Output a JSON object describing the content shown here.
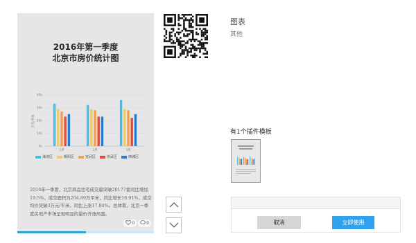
{
  "preview": {
    "title_line1": "2016年第一季度",
    "title_line2": "北京市房价统计图",
    "description": "2016年一季度，北京商品住宅成交量突破20177套同比增加19.5%，成交面积为204.89万平米，同比增长16.91%，成交均价突破3万元/平米，同比上涨17.84%。总体看，北京一季度房地产市场呈现明显的量价齐涨局面。",
    "likes": "0",
    "comments": "0",
    "progress": 0.5
  },
  "chart_data": {
    "type": "bar",
    "ylabel": "万元/平米",
    "yticks": [
      "0k",
      "10k",
      "20k",
      "30k",
      "40k"
    ],
    "ylim": [
      0,
      40
    ],
    "categories": [
      "1月",
      "2月",
      "3月"
    ],
    "series": [
      {
        "name": "海淀区",
        "color": "#3ec1f0",
        "values": [
          33,
          32,
          36
        ]
      },
      {
        "name": "朝阳区",
        "color": "#f5c86a",
        "values": [
          29,
          29,
          29
        ]
      },
      {
        "name": "宣武区",
        "color": "#f5a04a",
        "values": [
          27,
          28,
          28
        ]
      },
      {
        "name": "崇武区",
        "color": "#e8483c",
        "values": [
          23,
          23,
          22
        ]
      },
      {
        "name": "西城区",
        "color": "#2979c9",
        "values": [
          25,
          23,
          25
        ]
      }
    ]
  },
  "info": {
    "category": "图表",
    "subcategory": "其他",
    "template_count_label": "有1个插件模板"
  },
  "actions": {
    "cancel_label": "取消",
    "use_label": "立即使用"
  },
  "colors": {
    "accent": "#2ea2ef",
    "progress": "#2aa3df"
  }
}
